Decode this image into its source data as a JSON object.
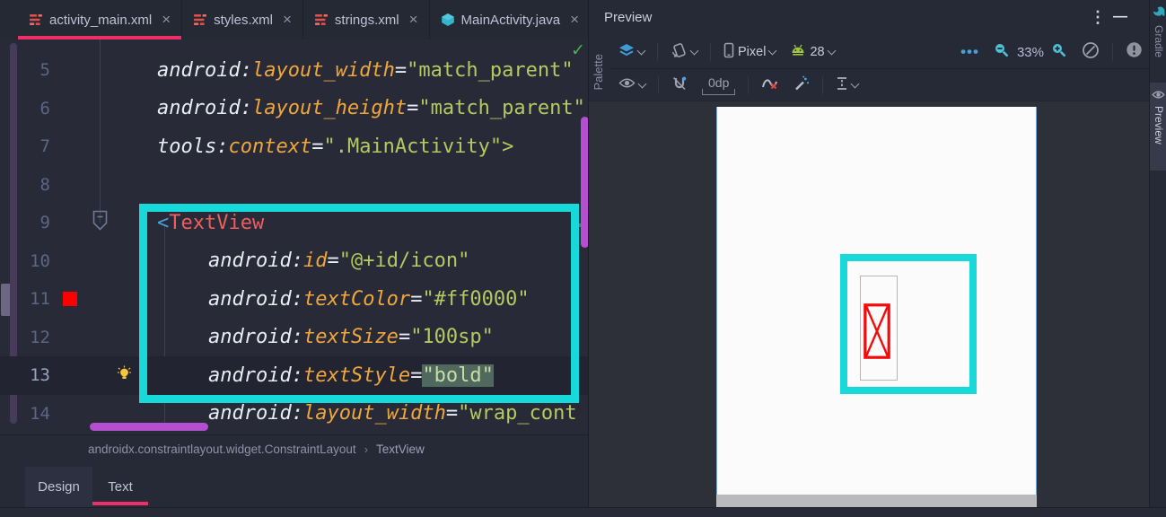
{
  "editor": {
    "tabs": [
      {
        "label": "activity_main.xml",
        "icon": "xml",
        "active": true
      },
      {
        "label": "styles.xml",
        "icon": "xml",
        "active": false
      },
      {
        "label": "strings.xml",
        "icon": "xml",
        "active": false
      },
      {
        "label": "MainActivity.java",
        "icon": "class",
        "active": false
      }
    ],
    "close_glyph": "×",
    "inspection_check": "✓",
    "code_lines": [
      {
        "num": "5",
        "indent": 0,
        "icon": null,
        "current": false,
        "tokens": [
          [
            "ns",
            "android:"
          ],
          [
            "attr",
            "layout_width"
          ],
          [
            "op",
            "="
          ],
          [
            "str",
            "\"match_parent\""
          ]
        ]
      },
      {
        "num": "6",
        "indent": 0,
        "icon": null,
        "current": false,
        "tokens": [
          [
            "ns",
            "android:"
          ],
          [
            "attr",
            "layout_height"
          ],
          [
            "op",
            "="
          ],
          [
            "str",
            "\"match_parent\""
          ]
        ]
      },
      {
        "num": "7",
        "indent": 0,
        "icon": null,
        "current": false,
        "tokens": [
          [
            "ns",
            "tools:"
          ],
          [
            "attr",
            "context"
          ],
          [
            "op",
            "="
          ],
          [
            "str",
            "\".MainActivity\""
          ],
          [
            "tag2",
            ">"
          ]
        ]
      },
      {
        "num": "8",
        "indent": 0,
        "icon": null,
        "current": false,
        "tokens": []
      },
      {
        "num": "9",
        "indent": 0,
        "icon": "fold",
        "current": false,
        "tokens": [
          [
            "tagb",
            "<"
          ],
          [
            "tagn",
            "TextView"
          ]
        ]
      },
      {
        "num": "10",
        "indent": 1,
        "icon": null,
        "current": false,
        "tokens": [
          [
            "ns",
            "android:"
          ],
          [
            "attr",
            "id"
          ],
          [
            "op",
            "="
          ],
          [
            "str",
            "\"@+id/icon\""
          ]
        ]
      },
      {
        "num": "11",
        "indent": 1,
        "icon": "swatch",
        "current": false,
        "tokens": [
          [
            "ns",
            "android:"
          ],
          [
            "attr",
            "textColor"
          ],
          [
            "op",
            "="
          ],
          [
            "str",
            "\"#ff0000\""
          ]
        ]
      },
      {
        "num": "12",
        "indent": 1,
        "icon": null,
        "current": false,
        "tokens": [
          [
            "ns",
            "android:"
          ],
          [
            "attr",
            "textSize"
          ],
          [
            "op",
            "="
          ],
          [
            "str",
            "\"100sp\""
          ]
        ]
      },
      {
        "num": "13",
        "indent": 1,
        "icon": "bulb",
        "current": true,
        "tokens": [
          [
            "ns",
            "android:"
          ],
          [
            "attr",
            "textStyle"
          ],
          [
            "op",
            "="
          ],
          [
            "sel",
            "\"bold\""
          ]
        ]
      },
      {
        "num": "14",
        "indent": 1,
        "icon": null,
        "current": false,
        "tokens": [
          [
            "ns",
            "android:"
          ],
          [
            "attr",
            "layout_width"
          ],
          [
            "op",
            "="
          ],
          [
            "str",
            "\"wrap_cont"
          ]
        ]
      }
    ],
    "breadcrumb": {
      "root": "androidx.constraintlayout.widget.ConstraintLayout",
      "sep": "›",
      "leaf": "TextView"
    },
    "bottom_tabs": {
      "design": "Design",
      "text": "Text"
    }
  },
  "preview": {
    "title": "Preview",
    "kebab_glyph": "⋮",
    "minimize_glyph": "—",
    "toolbar": {
      "device": "Pixel",
      "api_level": "28",
      "zoom_level": "33%",
      "margin": "0dp",
      "more_glyph": "•••"
    },
    "palette_label": "Palette"
  },
  "right_rail": {
    "gradle_label": "Gradle",
    "preview_label": "Preview"
  },
  "colors": {
    "accent_pink": "#ee2d69",
    "selection_cyan": "#17d9d9",
    "error_red": "#ff0000",
    "scrollbar_purple": "#b44fd0",
    "attr_orange": "#efa63c",
    "string_green": "#b6c861",
    "tag_red": "#ef5e5e"
  }
}
